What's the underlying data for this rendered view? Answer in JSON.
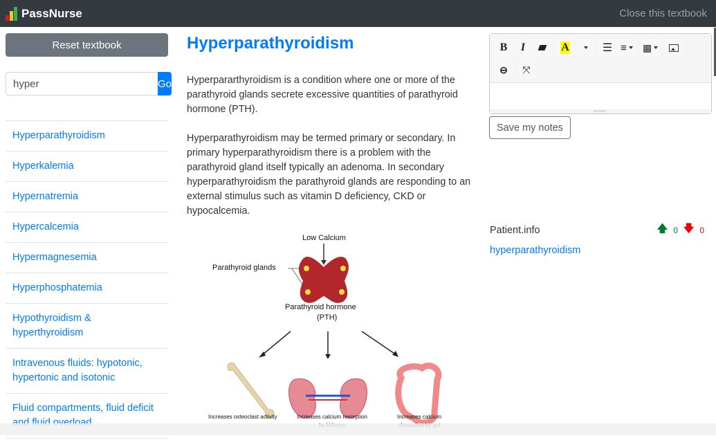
{
  "navbar": {
    "brand": "PassNurse",
    "logo_colors": [
      "#e8151b",
      "#f4c530",
      "#35b449"
    ],
    "close_label": "Close this textbook"
  },
  "sidebar": {
    "reset_label": "Reset textbook",
    "search": {
      "value": "hyper",
      "button_label": "Go"
    },
    "items": [
      {
        "label": "Hyperparathyroidism"
      },
      {
        "label": "Hyperkalemia"
      },
      {
        "label": "Hypernatremia"
      },
      {
        "label": "Hypercalcemia"
      },
      {
        "label": "Hypermagnesemia"
      },
      {
        "label": "Hyperphosphatemia"
      },
      {
        "label": "Hypothyroidism & hyperthyroidism"
      },
      {
        "label": "Intravenous fluids: hypotonic, hypertonic and isotonic"
      },
      {
        "label": "Fluid compartments, fluid deficit and fluid overload"
      }
    ]
  },
  "article": {
    "title": "Hyperparathyroidism",
    "paragraphs": [
      "Hyperpararthyroidism is a condition where one or more of the parathyroid glands secrete excessive quantities of parathyroid hormone (PTH).",
      "Hyperparathyroidism may be termed primary or secondary. In primary hyperparathyroidism there is a problem with the parathyroid gland itself typically an adenoma. In secondary hyperparathyroidism the parathyroid glands are responding to an external stimulus such as vitamin D deficiency, CKD or hypocalcemia."
    ],
    "figure": {
      "low_calcium": "Low Calcium",
      "glands_label": "Parathyroid glands",
      "hormone_label": "Parathyroid hormone",
      "hormone_abbr": "(PTH)",
      "bone_caption": "Increases osteoclast activity",
      "kidney_caption_1": "Increases calcium resorption",
      "kidney_caption_2": "by kidneys",
      "gut_caption_1": "Increases calcium",
      "gut_caption_2": "absorption by gut"
    }
  },
  "notes": {
    "toolbar": {
      "bold": "B",
      "italic": "I",
      "highlight": "A"
    },
    "save_label": "Save my notes",
    "tag": {
      "label": "Patient.info",
      "upvotes": "0",
      "downvotes": "0",
      "link": "hyperparathyroidism"
    }
  }
}
